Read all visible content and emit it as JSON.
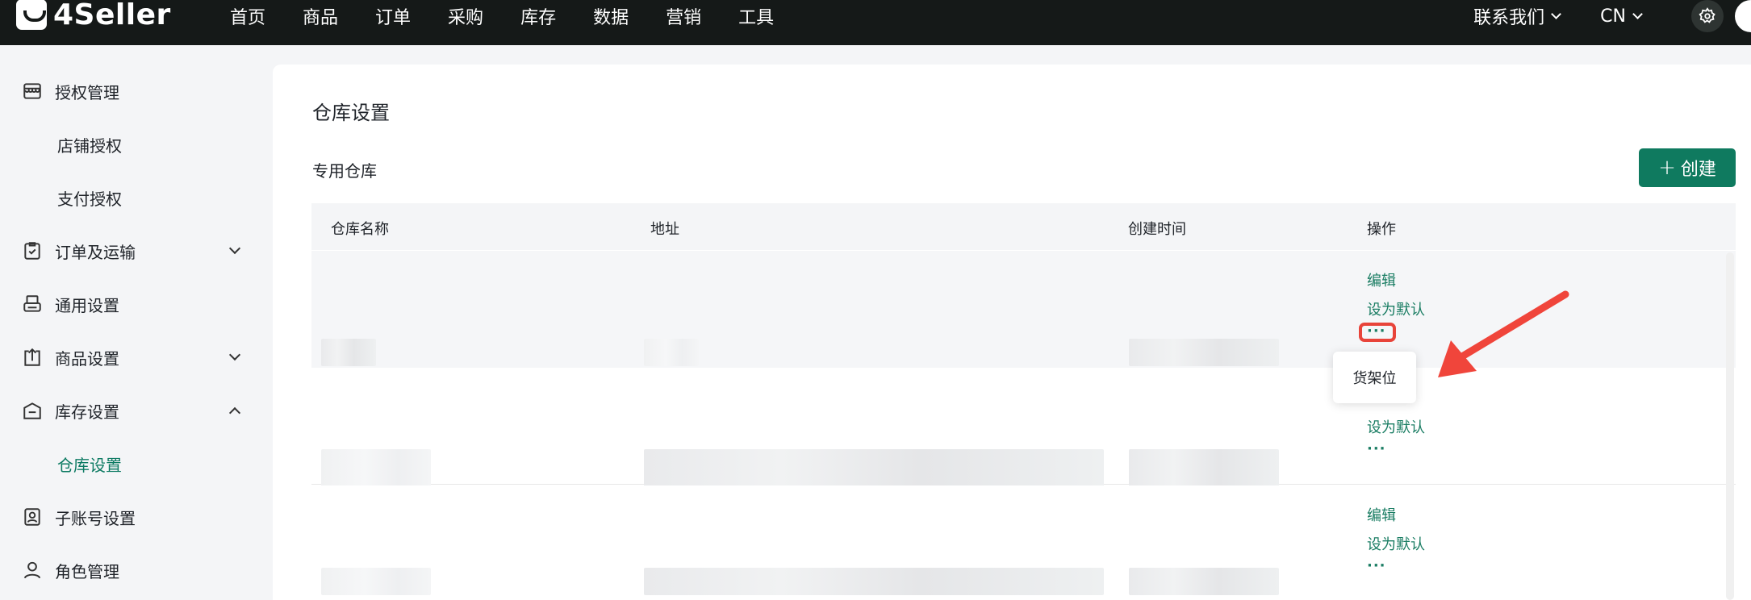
{
  "brand": {
    "name": "4Seller"
  },
  "nav": [
    "首页",
    "商品",
    "订单",
    "采购",
    "库存",
    "数据",
    "营销",
    "工具"
  ],
  "topRight": {
    "contact": "联系我们",
    "lang": "CN"
  },
  "sidebar": {
    "items": [
      {
        "label": "授权管理",
        "icon": "shop-icon"
      },
      {
        "label": "店铺授权"
      },
      {
        "label": "支付授权"
      },
      {
        "label": "订单及运输",
        "icon": "order-icon"
      },
      {
        "label": "通用设置",
        "icon": "printer-icon"
      },
      {
        "label": "商品设置",
        "icon": "upload-box-icon"
      },
      {
        "label": "库存设置",
        "icon": "warehouse-icon"
      },
      {
        "label": "仓库设置"
      },
      {
        "label": "子账号设置",
        "icon": "id-card-icon"
      },
      {
        "label": "角色管理",
        "icon": "user-icon"
      }
    ]
  },
  "page": {
    "title": "仓库设置",
    "section": "专用仓库",
    "create": "创建",
    "columns": {
      "name": "仓库名称",
      "address": "地址",
      "created": "创建时间",
      "actions": "操作"
    },
    "actions": {
      "edit": "编辑",
      "setDefault": "设为默认",
      "more": "···"
    },
    "dropdown": {
      "item": "货架位"
    }
  },
  "colors": {
    "accent": "#0f7a5f",
    "highlight": "#e8443a",
    "topbar": "#151918"
  }
}
